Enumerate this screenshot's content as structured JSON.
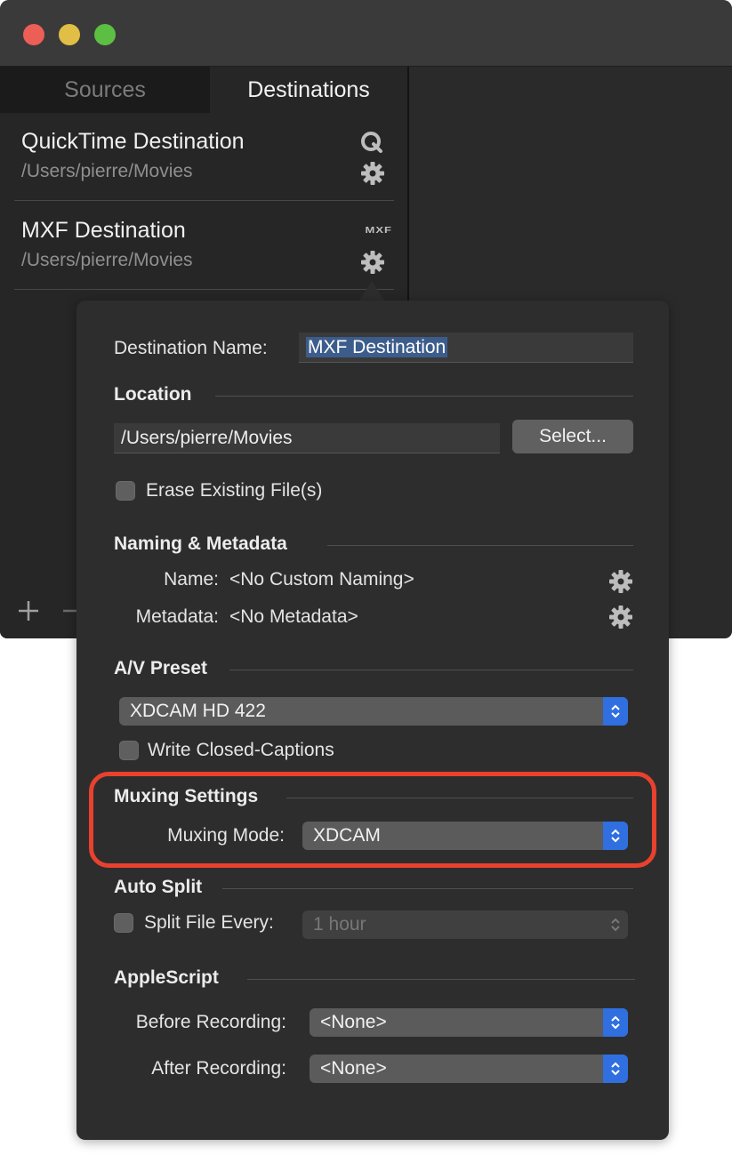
{
  "sidebar": {
    "tabs": [
      {
        "label": "Sources",
        "active": false
      },
      {
        "label": "Destinations",
        "active": true
      }
    ],
    "destinations": [
      {
        "title": "QuickTime Destination",
        "path": "/Users/pierre/Movies",
        "type_icon": "quicktime-icon"
      },
      {
        "title": "MXF Destination",
        "path": "/Users/pierre/Movies",
        "type_icon": "mxf-icon",
        "type_label": "MXF"
      }
    ]
  },
  "popover": {
    "destination_name_label": "Destination Name:",
    "destination_name_value": "MXF Destination",
    "location": {
      "section_title": "Location",
      "path_value": "/Users/pierre/Movies",
      "select_button": "Select...",
      "erase_label": "Erase Existing File(s)",
      "erase_checked": false
    },
    "naming": {
      "section_title": "Naming & Metadata",
      "name_label": "Name:",
      "name_value": "<No Custom Naming>",
      "metadata_label": "Metadata:",
      "metadata_value": "<No Metadata>"
    },
    "av_preset": {
      "section_title": "A/V Preset",
      "selected": "XDCAM HD 422",
      "closed_captions_label": "Write Closed-Captions",
      "closed_captions_checked": false
    },
    "muxing": {
      "section_title": "Muxing Settings",
      "mode_label": "Muxing Mode:",
      "mode_value": "XDCAM"
    },
    "auto_split": {
      "section_title": "Auto Split",
      "split_label": "Split File Every:",
      "split_value": "1 hour",
      "split_checked": false,
      "split_enabled": false
    },
    "applescript": {
      "section_title": "AppleScript",
      "before_label": "Before Recording:",
      "before_value": "<None>",
      "after_label": "After Recording:",
      "after_value": "<None>"
    }
  },
  "colors": {
    "accent": "#2f6fe0",
    "highlight": "#e8412e",
    "window_bg": "#2a2a2a"
  }
}
